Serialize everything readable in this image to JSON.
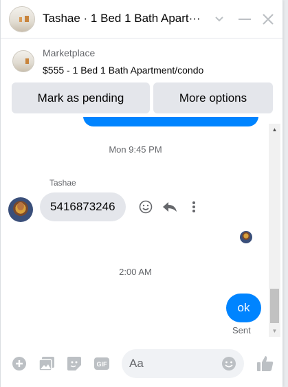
{
  "header": {
    "title": "Tashae · 1 Bed 1 Bath Apart···",
    "icons": [
      "chevron-down-icon",
      "minimize-icon",
      "close-icon"
    ]
  },
  "marketplace": {
    "label": "Marketplace",
    "listing": "$555 - 1 Bed 1 Bath Apartment/condo",
    "buttons": {
      "pending": "Mark as pending",
      "more": "More options"
    }
  },
  "messages": {
    "timestamp1": "Mon 9:45 PM",
    "sender_name": "Tashae",
    "received_text": "5416873246",
    "timestamp2": "2:00 AM",
    "sent_text": "ok",
    "sent_status": "Sent"
  },
  "composer": {
    "placeholder": "Aa",
    "icons": [
      "plus-circle-icon",
      "photo-icon",
      "sticker-icon",
      "gif-icon",
      "emoji-icon",
      "thumbs-up-icon"
    ]
  },
  "colors": {
    "accent": "#0084ff",
    "bubble_gray": "#e4e6eb",
    "muted_text": "#65676b",
    "icon_blue_gray": "#bcc0c4"
  }
}
